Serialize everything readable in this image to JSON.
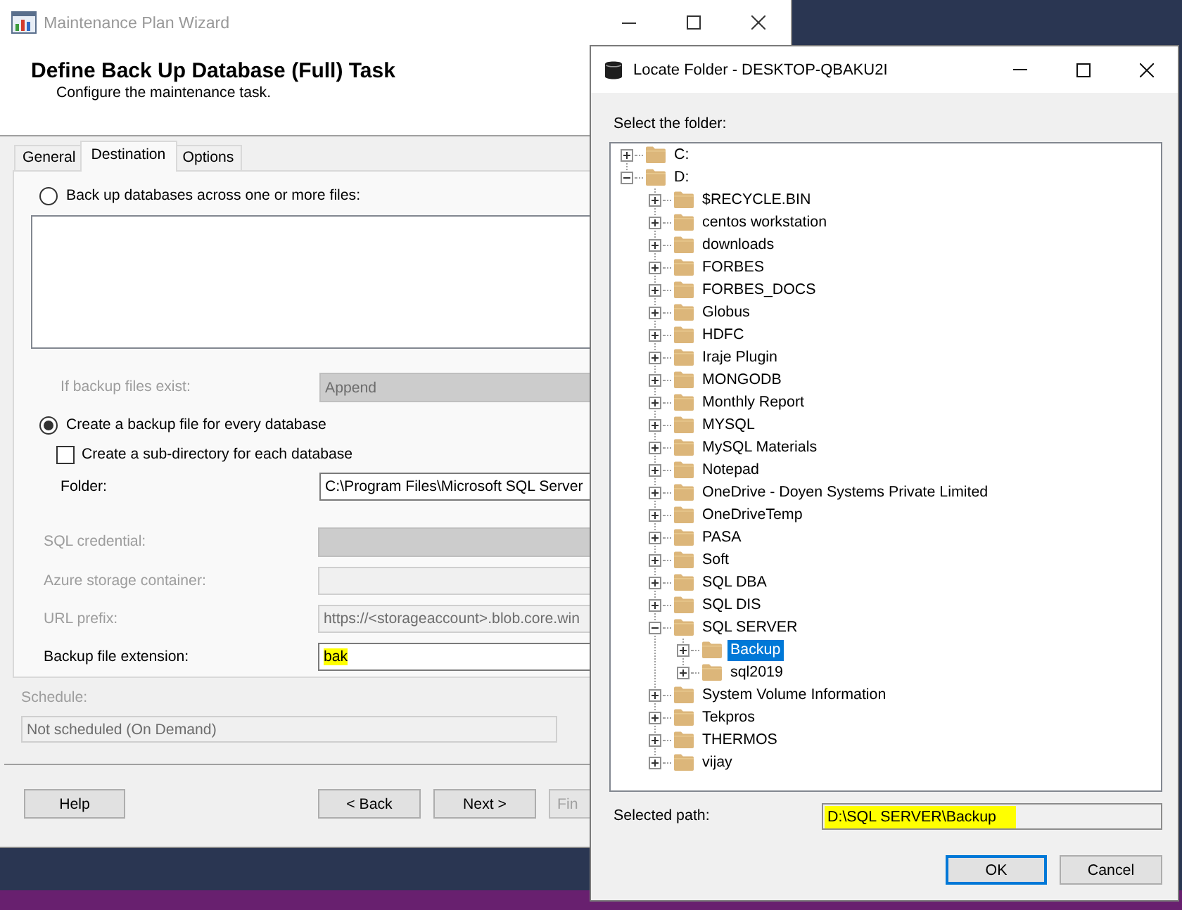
{
  "wizard": {
    "title": "Maintenance Plan Wizard",
    "active": false,
    "header": {
      "title": "Define Back Up Database (Full) Task",
      "subtitle": "Configure the maintenance task."
    },
    "tabs": [
      {
        "label": "General",
        "selected": false
      },
      {
        "label": "Destination",
        "selected": true
      },
      {
        "label": "Options",
        "selected": false
      }
    ],
    "rows": [
      {
        "kind": "radio",
        "label": "Back up databases across one or more files:",
        "selected": false
      },
      {
        "kind": "listbox"
      },
      {
        "kind": "dropdown",
        "label": "If backup files exist:",
        "value": "Append",
        "disabled": true,
        "highlighted": false
      },
      {
        "kind": "radio",
        "label": "Create a backup file for every database",
        "selected": true
      },
      {
        "kind": "checkbox",
        "label": "Create a sub-directory for each database",
        "checked": false
      },
      {
        "kind": "text",
        "label": "Folder:",
        "value": "C:\\Program Files\\Microsoft SQL Server",
        "disabled": false,
        "highlighted": false
      }
    ],
    "url_fields": [
      {
        "kind": "dropdown",
        "label": "SQL credential:",
        "disabled": true
      },
      {
        "kind": "text",
        "label": "Azure storage container:",
        "disabled": true
      },
      {
        "kind": "text",
        "label": "URL prefix:",
        "value": "https://<storageaccount>.blob.core.win",
        "disabled": true,
        "highlighted": false
      },
      {
        "kind": "text",
        "label": "Backup file extension:",
        "value": "bak",
        "disabled": false,
        "highlighted": true
      }
    ],
    "schedule": {
      "label": "Schedule:",
      "value": "Not scheduled (On Demand)",
      "disabled": true
    },
    "help_button": {
      "label": "Help",
      "disabled": false
    },
    "nav_buttons": [
      {
        "label": "< Back",
        "disabled": false
      },
      {
        "label": "Next >",
        "disabled": false
      },
      {
        "label": "Fin",
        "disabled": true
      }
    ]
  },
  "dialog": {
    "title": "Locate Folder - DESKTOP-QBAKU2I",
    "active": true,
    "prompt": "Select the folder:",
    "tree": [
      {
        "label": "C:",
        "expanded": false,
        "selected": false
      },
      {
        "label": "D:",
        "expanded": true,
        "selected": false,
        "children": [
          {
            "label": "$RECYCLE.BIN",
            "expanded": false,
            "selected": false
          },
          {
            "label": "centos workstation",
            "expanded": false,
            "selected": false
          },
          {
            "label": "downloads",
            "expanded": false,
            "selected": false
          },
          {
            "label": "FORBES",
            "expanded": false,
            "selected": false
          },
          {
            "label": "FORBES_DOCS",
            "expanded": false,
            "selected": false
          },
          {
            "label": "Globus",
            "expanded": false,
            "selected": false
          },
          {
            "label": "HDFC",
            "expanded": false,
            "selected": false
          },
          {
            "label": "Iraje Plugin",
            "expanded": false,
            "selected": false
          },
          {
            "label": "MONGODB",
            "expanded": false,
            "selected": false
          },
          {
            "label": "Monthly Report",
            "expanded": false,
            "selected": false
          },
          {
            "label": "MYSQL",
            "expanded": false,
            "selected": false
          },
          {
            "label": "MySQL Materials",
            "expanded": false,
            "selected": false
          },
          {
            "label": "Notepad",
            "expanded": false,
            "selected": false
          },
          {
            "label": "OneDrive - Doyen Systems Private Limited",
            "expanded": false,
            "selected": false
          },
          {
            "label": "OneDriveTemp",
            "expanded": false,
            "selected": false
          },
          {
            "label": "PASA",
            "expanded": false,
            "selected": false
          },
          {
            "label": "Soft",
            "expanded": false,
            "selected": false
          },
          {
            "label": "SQL DBA",
            "expanded": false,
            "selected": false
          },
          {
            "label": "SQL DIS",
            "expanded": false,
            "selected": false
          },
          {
            "label": "SQL SERVER",
            "expanded": true,
            "selected": false,
            "children": [
              {
                "label": "Backup",
                "expanded": false,
                "selected": true
              },
              {
                "label": "sql2019",
                "expanded": false,
                "selected": false
              }
            ]
          },
          {
            "label": "System Volume Information",
            "expanded": false,
            "selected": false
          },
          {
            "label": "Tekpros",
            "expanded": false,
            "selected": false
          },
          {
            "label": "THERMOS",
            "expanded": false,
            "selected": false
          },
          {
            "label": "vijay",
            "expanded": false,
            "selected": false
          }
        ]
      }
    ],
    "path": {
      "label": "Selected path:",
      "value": "D:\\SQL SERVER\\Backup",
      "highlighted": true
    },
    "buttons": [
      {
        "label": "OK",
        "default": true
      },
      {
        "label": "Cancel",
        "default": false
      }
    ]
  }
}
